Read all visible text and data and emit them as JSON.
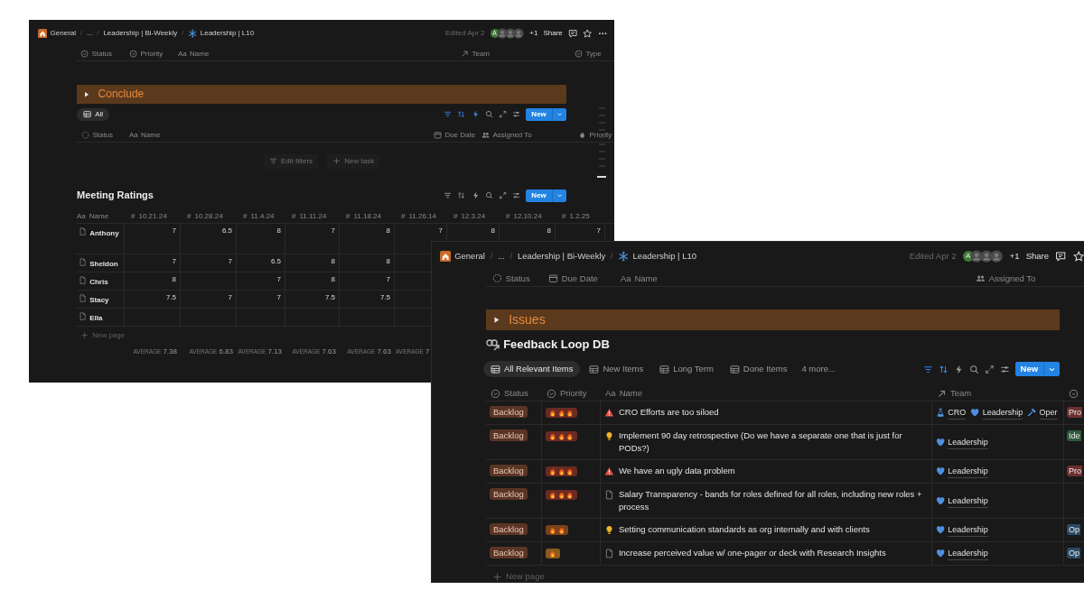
{
  "left_window": {
    "breadcrumb": [
      {
        "kind": "workspace",
        "text": "General"
      },
      {
        "kind": "ellipsis",
        "text": "..."
      },
      {
        "kind": "parent",
        "text": "Leadership | Bi-Weekly"
      },
      {
        "kind": "current",
        "text": "Leadership | L10"
      }
    ],
    "breadcrumb_separator": "/",
    "edited": "Edited Apr 2",
    "avatars": [
      {
        "kind": "letter",
        "text": "A"
      },
      {
        "kind": "blurred"
      },
      {
        "kind": "blurred"
      },
      {
        "kind": "blurred"
      }
    ],
    "more_people": "+1",
    "share": "Share",
    "header_actions": [
      {
        "kind": "comment"
      },
      {
        "kind": "star"
      },
      {
        "kind": "more"
      }
    ],
    "properties": [
      {
        "kind": "select",
        "label": "Status"
      },
      {
        "kind": "select",
        "label": "Priority"
      },
      {
        "kind": "title",
        "glyph": "Aa",
        "label": "Name"
      },
      {
        "kind": "relation",
        "label": "Team"
      },
      {
        "kind": "select",
        "label": "Type"
      }
    ],
    "toggle_heading": "Conclude",
    "tasks": {
      "tabs": [
        {
          "label": "All",
          "selected": true
        }
      ],
      "toolbar": [
        {
          "kind": "filter",
          "active": true
        },
        {
          "kind": "sort",
          "active": true
        },
        {
          "kind": "bolt",
          "active": true
        },
        {
          "kind": "search",
          "active": false
        },
        {
          "kind": "expand",
          "active": false
        },
        {
          "kind": "sliders",
          "active": false
        }
      ],
      "new_button": "New",
      "columns": [
        {
          "kind": "status",
          "label": "Status"
        },
        {
          "kind": "title",
          "glyph": "Aa",
          "label": "Name"
        },
        {
          "kind": "date",
          "label": "Due Date"
        },
        {
          "kind": "person",
          "label": "Assigned To"
        },
        {
          "kind": "priority",
          "label": "Priority"
        }
      ],
      "empty_actions": [
        {
          "kind": "filter",
          "label": "Edit filters"
        },
        {
          "kind": "plus",
          "label": "New task"
        }
      ]
    },
    "ratings": {
      "title": "Meeting Ratings",
      "toolbar": [
        {
          "kind": "filter",
          "active": false
        },
        {
          "kind": "sort",
          "active": false
        },
        {
          "kind": "bolt",
          "active": false
        },
        {
          "kind": "search",
          "active": false
        },
        {
          "kind": "expand",
          "active": false
        },
        {
          "kind": "sliders",
          "active": false
        }
      ],
      "new_button": "New",
      "name_column": {
        "glyph": "Aa",
        "label": "Name"
      },
      "number_glyph": "#",
      "columns": [
        "10.21.24",
        "10.28.24",
        "11.4.24",
        "11.11.24",
        "11.18.24",
        "11.26.14",
        "12.3.24",
        "12.10.24",
        "1.2.25"
      ],
      "rows": [
        {
          "name": "Anthony",
          "cells": [
            {
              "value": "7"
            },
            {
              "value": "6.5"
            },
            {
              "value": "8"
            },
            {
              "value": "7"
            },
            {
              "value": "8"
            },
            {
              "value": "7"
            },
            {
              "value": "8"
            },
            {
              "value": "8"
            },
            {
              "value": "7"
            }
          ]
        },
        {
          "name": "Sheldon",
          "cells": [
            {
              "value": "7"
            },
            {
              "value": "7"
            },
            {
              "value": "6.5"
            },
            {
              "value": "8"
            },
            {
              "value": "8"
            }
          ]
        },
        {
          "name": "Chris",
          "cells": [
            {
              "value": "8"
            },
            {},
            {
              "value": "7"
            },
            {
              "value": "8"
            },
            {
              "value": "7"
            }
          ]
        },
        {
          "name": "Stacy",
          "cells": [
            {
              "value": "7.5"
            },
            {
              "value": "7"
            },
            {
              "value": "7"
            },
            {
              "value": "7.5"
            },
            {
              "value": "7.5"
            }
          ]
        },
        {
          "name": "Ella"
        }
      ],
      "new_page": "New page",
      "averages": [
        {
          "label": "AVERAGE",
          "value": "7.38"
        },
        {
          "label": "AVERAGE",
          "value": "6.83"
        },
        {
          "label": "AVERAGE",
          "value": "7.13"
        },
        {
          "label": "AVERAGE",
          "value": "7.63"
        },
        {
          "label": "AVERAGE",
          "value": "7.63"
        },
        {
          "label": "AVERAGE",
          "value": "7"
        }
      ]
    }
  },
  "right_window": {
    "breadcrumb": [
      {
        "kind": "workspace",
        "text": "General"
      },
      {
        "kind": "ellipsis",
        "text": "..."
      },
      {
        "kind": "parent",
        "text": "Leadership | Bi-Weekly"
      },
      {
        "kind": "current",
        "text": "Leadership | L10"
      }
    ],
    "breadcrumb_separator": "/",
    "edited": "Edited Apr 2",
    "avatars": [
      {
        "kind": "letter",
        "text": "A"
      },
      {
        "kind": "blurred"
      },
      {
        "kind": "blurred"
      },
      {
        "kind": "blurred"
      }
    ],
    "more_people": "+1",
    "share": "Share",
    "header_actions": [
      {
        "kind": "comment"
      },
      {
        "kind": "star"
      }
    ],
    "properties": [
      {
        "kind": "status",
        "label": "Status"
      },
      {
        "kind": "date",
        "label": "Due Date"
      },
      {
        "kind": "title",
        "glyph": "Aa",
        "label": "Name"
      },
      {
        "kind": "person",
        "label": "Assigned To"
      }
    ],
    "toggle_heading": "Issues",
    "database_title": "Feedback Loop DB",
    "tabs": [
      {
        "label": "All Relevant Items",
        "selected": true
      },
      {
        "label": "New Items",
        "selected": false
      },
      {
        "label": "Long Term",
        "selected": false
      },
      {
        "label": "Done Items",
        "selected": false
      }
    ],
    "more_tabs": "4 more...",
    "toolbar": [
      {
        "kind": "filter",
        "active": true
      },
      {
        "kind": "sort",
        "active": true
      },
      {
        "kind": "bolt",
        "active": false
      },
      {
        "kind": "search",
        "active": false
      },
      {
        "kind": "expand",
        "active": false
      },
      {
        "kind": "sliders",
        "active": false
      }
    ],
    "new_button": "New",
    "columns": [
      {
        "kind": "select",
        "label": "Status"
      },
      {
        "kind": "select",
        "label": "Priority"
      },
      {
        "kind": "title",
        "glyph": "Aa",
        "label": "Name"
      },
      {
        "kind": "relation",
        "label": "Team"
      },
      {
        "kind": "select"
      }
    ],
    "rows": [
      {
        "status": "Backlog",
        "priority": {
          "kind": "high"
        },
        "kind": "warning",
        "name": "CRO Efforts are too siloed",
        "team": [
          {
            "kind": "flask",
            "name": "CRO"
          },
          {
            "kind": "heart",
            "name": "Leadership"
          },
          {
            "kind": "hammer",
            "name": "Oper"
          }
        ],
        "tag": {
          "text": "Pro",
          "color": "#6e2f2f"
        }
      },
      {
        "status": "Backlog",
        "priority": {
          "kind": "high"
        },
        "kind": "idea",
        "name": "Implement 90 day retrospective (Do we have a separate one that is just for PODs?)",
        "team": [
          {
            "kind": "heart",
            "name": "Leadership"
          }
        ],
        "tag": {
          "text": "Ide",
          "color": "#2f5a3c"
        }
      },
      {
        "status": "Backlog",
        "priority": {
          "kind": "high"
        },
        "kind": "warning",
        "name": "We have an ugly data problem",
        "team": [
          {
            "kind": "heart",
            "name": "Leadership"
          }
        ],
        "tag": {
          "text": "Pro",
          "color": "#6e2f2f"
        }
      },
      {
        "status": "Backlog",
        "priority": {
          "kind": "high"
        },
        "kind": "page",
        "name": "Salary Transparency - bands for roles defined for all roles, including new roles + process",
        "team": [
          {
            "kind": "heart",
            "name": "Leadership"
          }
        ]
      },
      {
        "status": "Backlog",
        "priority": {
          "kind": "medium"
        },
        "kind": "idea",
        "name": "Setting communication standards as org internally and with clients",
        "team": [
          {
            "kind": "heart",
            "name": "Leadership"
          }
        ],
        "tag": {
          "text": "Op",
          "color": "#2a4a66"
        }
      },
      {
        "status": "Backlog",
        "priority": {
          "kind": "low"
        },
        "kind": "page",
        "name": "Increase perceived value w/ one-pager or deck with Research Insights",
        "team": [
          {
            "kind": "heart",
            "name": "Leadership"
          }
        ],
        "tag": {
          "text": "Op",
          "color": "#2a4a66"
        }
      }
    ],
    "new_page": "New page"
  }
}
